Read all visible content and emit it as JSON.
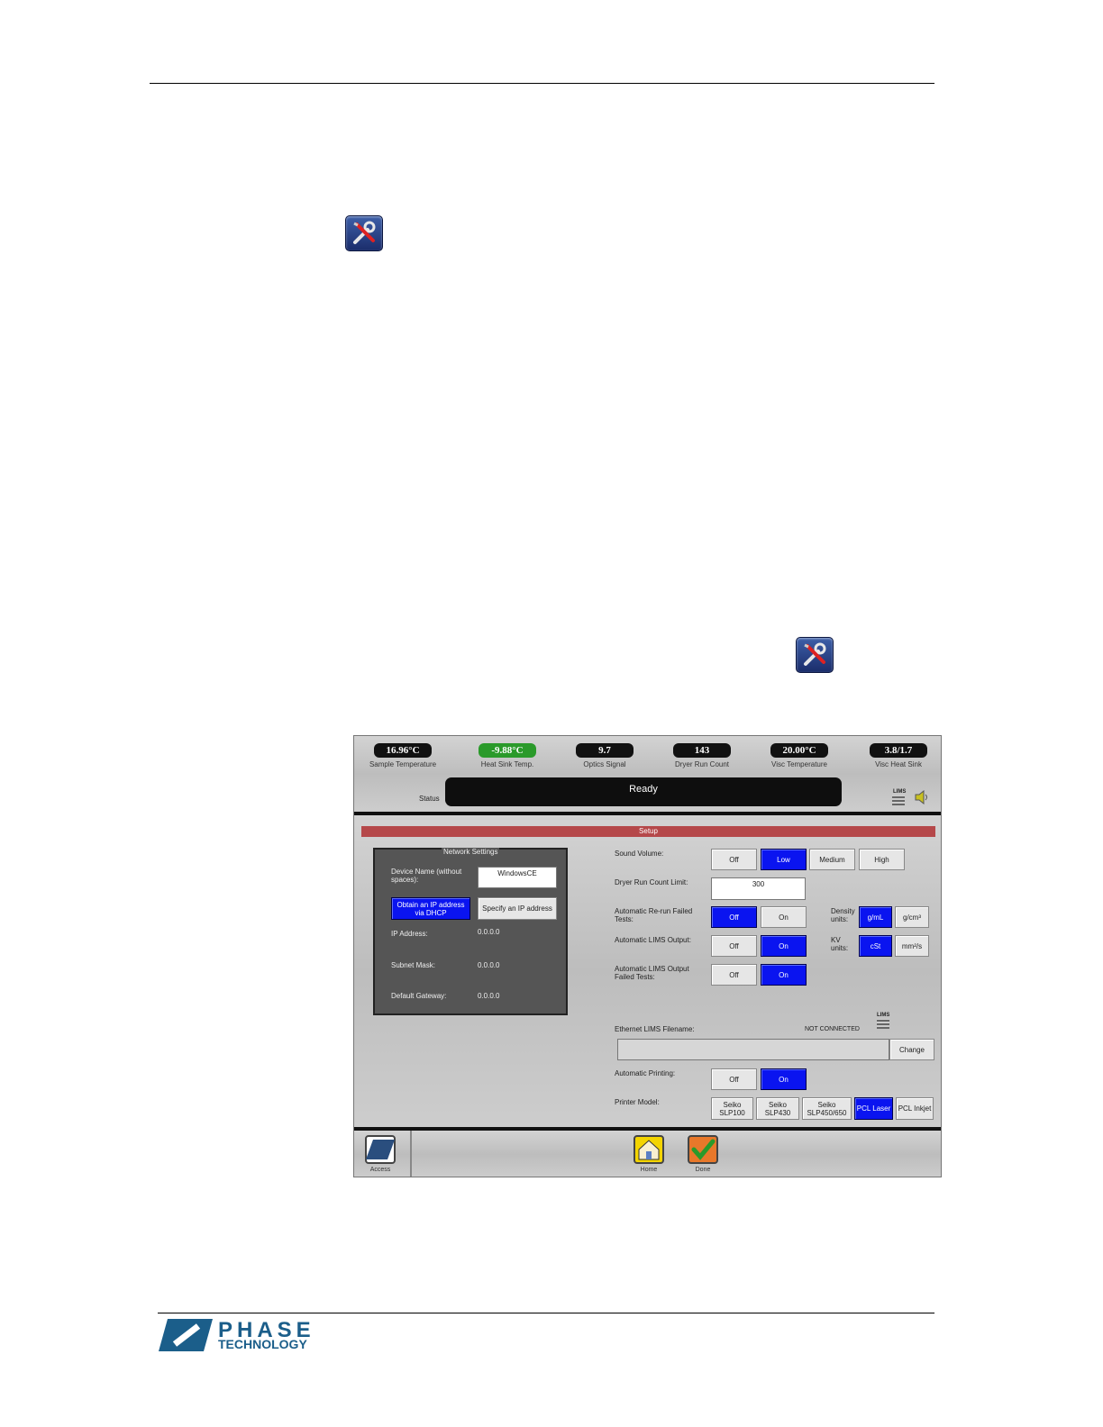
{
  "setup_screen": {
    "gauges": [
      {
        "value": "16.96°C",
        "label": "Sample Temperature",
        "color": "#111111"
      },
      {
        "value": "-9.88°C",
        "label": "Heat Sink Temp.",
        "color": "#2a9a2a"
      },
      {
        "value": "9.7",
        "label": "Optics Signal",
        "color": "#111111"
      },
      {
        "value": "143",
        "label": "Dryer Run Count",
        "color": "#111111"
      },
      {
        "value": "20.00°C",
        "label": "Visc Temperature",
        "color": "#111111"
      },
      {
        "value": "3.8/1.7",
        "label": "Visc Heat Sink",
        "color": "#111111"
      }
    ],
    "status_label": "Status",
    "status_text": "Ready",
    "lims_icon_label": "LIMS",
    "setup_title": "Setup",
    "network": {
      "title": "Network Settings",
      "device_name_label": "Device Name (without spaces):",
      "device_name_value": "WindowsCE",
      "dhcp_button": "Obtain an IP address via DHCP",
      "specify_ip_button": "Specify an IP address",
      "ip_label": "IP Address:",
      "ip_value": "0.0.0.0",
      "subnet_label": "Subnet Mask:",
      "subnet_value": "0.0.0.0",
      "gateway_label": "Default Gateway:",
      "gateway_value": "0.0.0.0"
    },
    "sound_volume": {
      "label": "Sound Volume:",
      "options": [
        "Off",
        "Low",
        "Medium",
        "High"
      ],
      "selected": "Low"
    },
    "dryer_limit": {
      "label": "Dryer Run Count Limit:",
      "value": "300"
    },
    "rerun": {
      "label": "Automatic Re-run Failed Tests:",
      "options": [
        "Off",
        "On"
      ],
      "selected": "Off"
    },
    "density": {
      "label": "Density units:",
      "options": [
        "g/mL",
        "g/cm³"
      ],
      "selected": "g/mL"
    },
    "lims_output": {
      "label": "Automatic LIMS Output:",
      "options": [
        "Off",
        "On"
      ],
      "selected": "On"
    },
    "kv": {
      "label": "KV units:",
      "options": [
        "cSt",
        "mm²/s"
      ],
      "selected": "cSt"
    },
    "lims_failed": {
      "label": "Automatic LIMS Output Failed Tests:",
      "options": [
        "Off",
        "On"
      ],
      "selected": "On"
    },
    "ethernet": {
      "label": "Ethernet LIMS Filename:",
      "status": "NOT CONNECTED",
      "change_button": "Change",
      "value": ""
    },
    "auto_print": {
      "label": "Automatic Printing:",
      "options": [
        "Off",
        "On"
      ],
      "selected": "On"
    },
    "printer": {
      "label": "Printer Model:",
      "options": [
        "Seiko SLP100",
        "Seiko SLP430",
        "Seiko SLP450/650",
        "PCL Laser",
        "PCL Inkjet"
      ],
      "selected": "PCL Laser"
    },
    "bottom": {
      "access": "Access",
      "home": "Home",
      "done": "Done"
    }
  },
  "footer_logo": {
    "line1": "PHASE",
    "line2": "TECHNOLOGY"
  }
}
